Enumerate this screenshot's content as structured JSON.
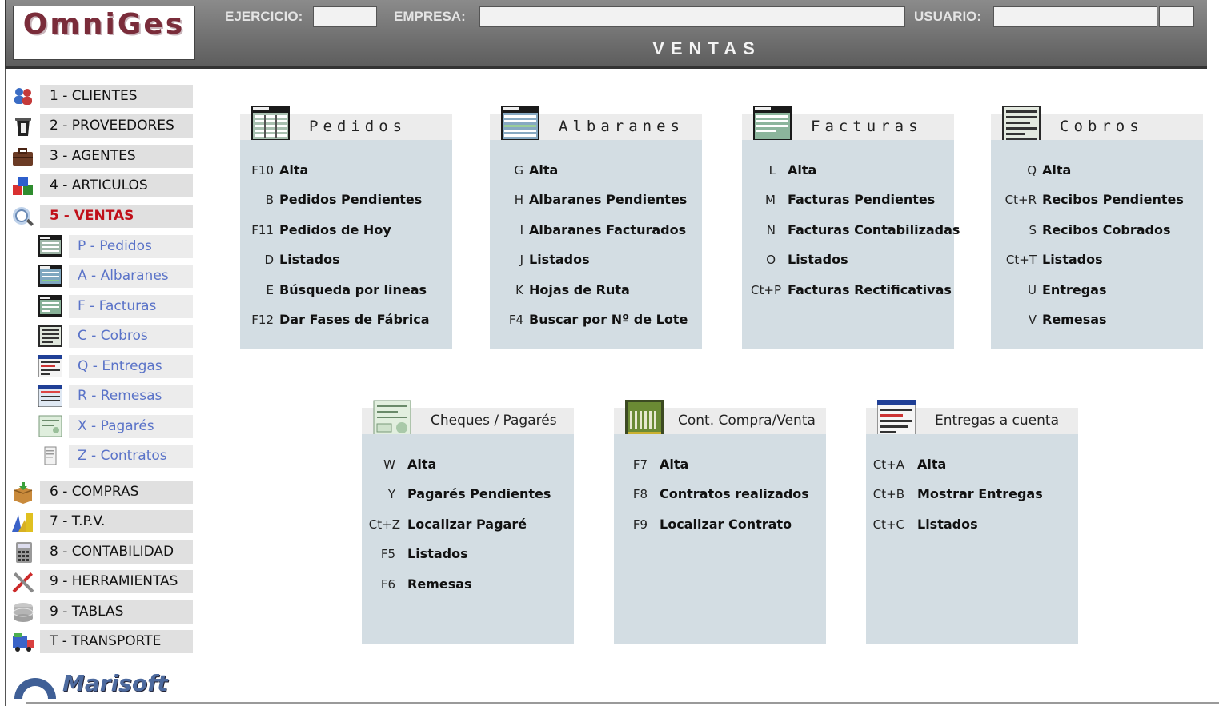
{
  "header": {
    "logo": "OmniGes",
    "ejercicio_label": "EJERCICIO:",
    "ejercicio_value": "",
    "empresa_label": "EMPRESA:",
    "empresa_value": "",
    "usuario_label": "USUARIO:",
    "usuario_value": "",
    "section_title": "VENTAS"
  },
  "sidebar": {
    "items": [
      {
        "label": "1 - CLIENTES",
        "icon": "clients-icon"
      },
      {
        "label": "2 - PROVEEDORES",
        "icon": "suppliers-icon"
      },
      {
        "label": "3 - AGENTES",
        "icon": "briefcase-icon"
      },
      {
        "label": "4 - ARTICULOS",
        "icon": "cubes-icon"
      },
      {
        "label": "5 - VENTAS",
        "icon": "sales-icon",
        "active": true
      }
    ],
    "subitems": [
      {
        "label": "P - Pedidos",
        "icon": "orders-icon"
      },
      {
        "label": "A - Albaranes",
        "icon": "delivery-notes-icon"
      },
      {
        "label": "F - Facturas",
        "icon": "invoices-icon"
      },
      {
        "label": "C - Cobros",
        "icon": "collections-icon"
      },
      {
        "label": "Q - Entregas",
        "icon": "deliveries-icon"
      },
      {
        "label": "R - Remesas",
        "icon": "remittances-icon"
      },
      {
        "label": "X - Pagarés",
        "icon": "promissory-notes-icon"
      },
      {
        "label": "Z - Contratos",
        "icon": "contracts-icon"
      }
    ],
    "items2": [
      {
        "label": "6 - COMPRAS",
        "icon": "purchases-box-icon"
      },
      {
        "label": "7 - T.P.V.",
        "icon": "pos-icon"
      },
      {
        "label": "8 - CONTABILIDAD",
        "icon": "calculator-icon"
      },
      {
        "label": "9 - HERRAMIENTAS",
        "icon": "tools-icon"
      },
      {
        "label": "9 - TABLAS",
        "icon": "database-icon"
      },
      {
        "label": "T - TRANSPORTE",
        "icon": "transport-icon"
      }
    ],
    "brand": "Marisoft"
  },
  "panels": {
    "pedidos": {
      "title": "Pedidos",
      "rows": [
        {
          "key": "F10",
          "label": "Alta"
        },
        {
          "key": "B",
          "label": "Pedidos Pendientes"
        },
        {
          "key": "F11",
          "label": "Pedidos de Hoy"
        },
        {
          "key": "D",
          "label": "Listados"
        },
        {
          "key": "E",
          "label": "Búsqueda por lineas"
        },
        {
          "key": "F12",
          "label": "Dar Fases de Fábrica"
        }
      ]
    },
    "albaranes": {
      "title": "Albaranes",
      "rows": [
        {
          "key": "G",
          "label": "Alta"
        },
        {
          "key": "H",
          "label": "Albaranes Pendientes"
        },
        {
          "key": "I",
          "label": "Albaranes Facturados"
        },
        {
          "key": "J",
          "label": "Listados"
        },
        {
          "key": "K",
          "label": "Hojas de Ruta"
        },
        {
          "key": "F4",
          "label": "Buscar por Nº de Lote"
        }
      ]
    },
    "facturas": {
      "title": "Facturas",
      "rows": [
        {
          "key": "L",
          "label": "Alta"
        },
        {
          "key": "M",
          "label": "Facturas Pendientes"
        },
        {
          "key": "N",
          "label": "Facturas Contabilizadas"
        },
        {
          "key": "O",
          "label": "Listados"
        },
        {
          "key": "Ct+P",
          "label": "Facturas Rectificativas"
        }
      ]
    },
    "cobros": {
      "title": "Cobros",
      "rows": [
        {
          "key": "Q",
          "label": "Alta"
        },
        {
          "key": "Ct+R",
          "label": "Recibos Pendientes"
        },
        {
          "key": "S",
          "label": "Recibos Cobrados"
        },
        {
          "key": "Ct+T",
          "label": "Listados"
        },
        {
          "key": "U",
          "label": "Entregas"
        },
        {
          "key": "V",
          "label": "Remesas"
        }
      ]
    },
    "cheques": {
      "title": "Cheques / Pagarés",
      "rows": [
        {
          "key": "W",
          "label": "Alta"
        },
        {
          "key": "Y",
          "label": "Pagarés Pendientes"
        },
        {
          "key": "Ct+Z",
          "label": "Localizar Pagaré"
        },
        {
          "key": "F5",
          "label": "Listados"
        },
        {
          "key": "F6",
          "label": "Remesas"
        }
      ]
    },
    "contratos": {
      "title": "Cont. Compra/Venta",
      "rows": [
        {
          "key": "F7",
          "label": "Alta"
        },
        {
          "key": "F8",
          "label": "Contratos realizados"
        },
        {
          "key": "F9",
          "label": "Localizar Contrato"
        }
      ]
    },
    "entregas": {
      "title": "Entregas a cuenta",
      "rows": [
        {
          "key": "Ct+A",
          "label": "Alta"
        },
        {
          "key": "Ct+B",
          "label": "Mostrar Entregas"
        },
        {
          "key": "Ct+C",
          "label": "Listados"
        }
      ]
    }
  }
}
